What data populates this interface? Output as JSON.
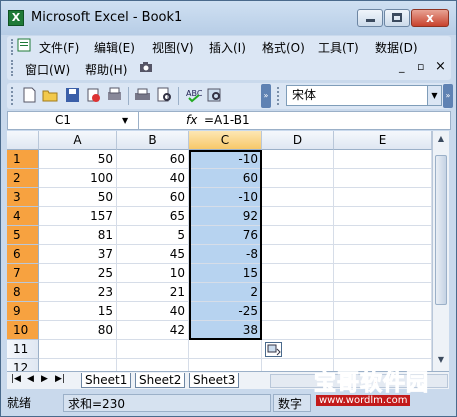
{
  "window": {
    "title": "Microsoft Excel - Book1",
    "close_label": "x"
  },
  "menu": {
    "items": [
      "文件(F)",
      "编辑(E)",
      "视图(V)",
      "插入(I)",
      "格式(O)",
      "工具(T)",
      "数据(D)",
      "窗口(W)",
      "帮助(H)"
    ],
    "mdi_min": "_",
    "mdi_restore": "▫",
    "mdi_close": "×"
  },
  "toolbar": {
    "font_name": "宋体"
  },
  "formula_bar": {
    "name_box": "C1",
    "fx": "fx",
    "formula": "=A1-B1"
  },
  "columns": [
    "A",
    "B",
    "C",
    "D",
    "E"
  ],
  "rows": [
    "1",
    "2",
    "3",
    "4",
    "5",
    "6",
    "7",
    "8",
    "9",
    "10",
    "11",
    "12"
  ],
  "cells": [
    [
      "50",
      "60",
      "-10"
    ],
    [
      "100",
      "40",
      "60"
    ],
    [
      "50",
      "60",
      "-10"
    ],
    [
      "157",
      "65",
      "92"
    ],
    [
      "81",
      "5",
      "76"
    ],
    [
      "37",
      "45",
      "-8"
    ],
    [
      "25",
      "10",
      "15"
    ],
    [
      "23",
      "21",
      "2"
    ],
    [
      "15",
      "40",
      "-25"
    ],
    [
      "80",
      "42",
      "38"
    ]
  ],
  "selection": {
    "column": "C",
    "rows": "1-10"
  },
  "sheets": [
    "Sheet1",
    "Sheet2",
    "Sheet3"
  ],
  "active_sheet": "Sheet1",
  "status": {
    "mode": "就绪",
    "sum": "求和=230",
    "numlock": "数字"
  },
  "watermark": {
    "main": "宝哥软件园",
    "url": "www.wordlm.com"
  },
  "colors": {
    "selection_fill": "#b7d3f0",
    "row_header_selected": "#f7a240"
  }
}
